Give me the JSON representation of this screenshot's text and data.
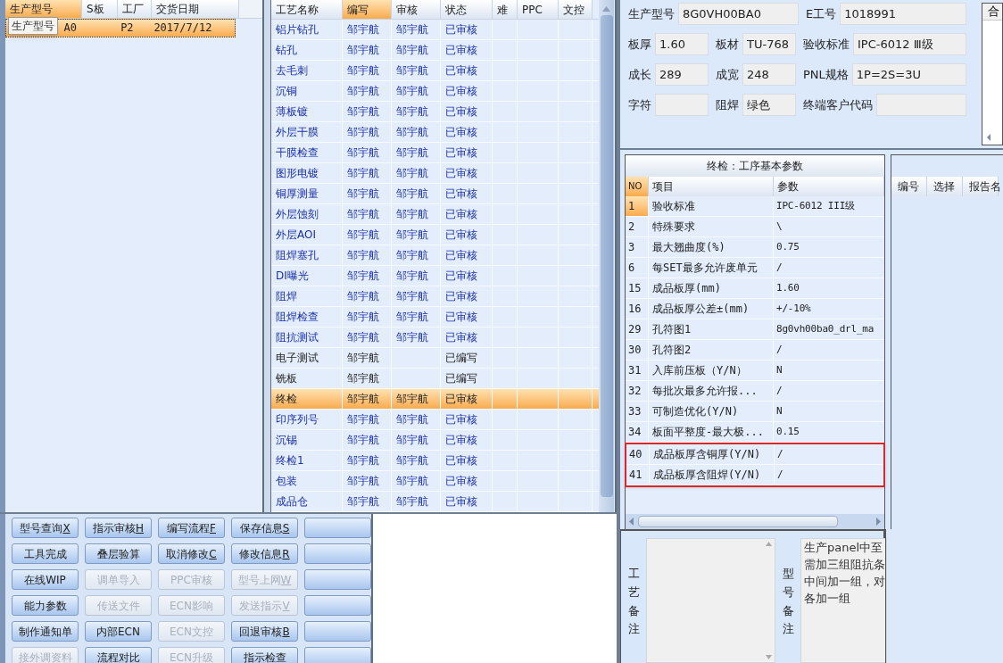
{
  "model_grid": {
    "columns": [
      {
        "label": "生产型号",
        "selected": true
      },
      {
        "label": "S板",
        "selected": false
      },
      {
        "label": "工厂",
        "selected": false
      },
      {
        "label": "交货日期",
        "selected": false
      }
    ],
    "rows": [
      {
        "cells": [
          "A0",
          "",
          "P2",
          "2017/7/12"
        ],
        "selected": true
      }
    ],
    "tooltip": "生产型号"
  },
  "process_grid": {
    "columns": [
      {
        "label": "工艺名称",
        "selected": false
      },
      {
        "label": "编写",
        "selected": true
      },
      {
        "label": "审核",
        "selected": false
      },
      {
        "label": "状态",
        "selected": false
      },
      {
        "label": "难",
        "selected": false
      },
      {
        "label": "PPC",
        "selected": false
      },
      {
        "label": "文控",
        "selected": false
      }
    ],
    "rows": [
      {
        "name": "铝片钻孔",
        "writer": "邹宇航",
        "reviewer": "邹宇航",
        "status": "已审核",
        "reviewed": true,
        "selected": false
      },
      {
        "name": "钻孔",
        "writer": "邹宇航",
        "reviewer": "邹宇航",
        "status": "已审核",
        "reviewed": true,
        "selected": false
      },
      {
        "name": "去毛刺",
        "writer": "邹宇航",
        "reviewer": "邹宇航",
        "status": "已审核",
        "reviewed": true,
        "selected": false
      },
      {
        "name": "沉铜",
        "writer": "邹宇航",
        "reviewer": "邹宇航",
        "status": "已审核",
        "reviewed": true,
        "selected": false
      },
      {
        "name": "薄板镀",
        "writer": "邹宇航",
        "reviewer": "邹宇航",
        "status": "已审核",
        "reviewed": true,
        "selected": false
      },
      {
        "name": "外层干膜",
        "writer": "邹宇航",
        "reviewer": "邹宇航",
        "status": "已审核",
        "reviewed": true,
        "selected": false
      },
      {
        "name": "干膜检查",
        "writer": "邹宇航",
        "reviewer": "邹宇航",
        "status": "已审核",
        "reviewed": true,
        "selected": false
      },
      {
        "name": "图形电镀",
        "writer": "邹宇航",
        "reviewer": "邹宇航",
        "status": "已审核",
        "reviewed": true,
        "selected": false
      },
      {
        "name": "铜厚测量",
        "writer": "邹宇航",
        "reviewer": "邹宇航",
        "status": "已审核",
        "reviewed": true,
        "selected": false
      },
      {
        "name": "外层蚀刻",
        "writer": "邹宇航",
        "reviewer": "邹宇航",
        "status": "已审核",
        "reviewed": true,
        "selected": false
      },
      {
        "name": "外层AOI",
        "writer": "邹宇航",
        "reviewer": "邹宇航",
        "status": "已审核",
        "reviewed": true,
        "selected": false
      },
      {
        "name": "阻焊塞孔",
        "writer": "邹宇航",
        "reviewer": "邹宇航",
        "status": "已审核",
        "reviewed": true,
        "selected": false
      },
      {
        "name": "DI曝光",
        "writer": "邹宇航",
        "reviewer": "邹宇航",
        "status": "已审核",
        "reviewed": true,
        "selected": false
      },
      {
        "name": "阻焊",
        "writer": "邹宇航",
        "reviewer": "邹宇航",
        "status": "已审核",
        "reviewed": true,
        "selected": false
      },
      {
        "name": "阻焊检查",
        "writer": "邹宇航",
        "reviewer": "邹宇航",
        "status": "已审核",
        "reviewed": true,
        "selected": false
      },
      {
        "name": "阻抗测试",
        "writer": "邹宇航",
        "reviewer": "邹宇航",
        "status": "已审核",
        "reviewed": true,
        "selected": false
      },
      {
        "name": "电子测试",
        "writer": "邹宇航",
        "status": "已编写",
        "reviewed": false,
        "selected": false
      },
      {
        "name": "铣板",
        "writer": "邹宇航",
        "status": "已编写",
        "reviewed": false,
        "selected": false
      },
      {
        "name": "终检",
        "writer": "邹宇航",
        "reviewer": "邹宇航",
        "status": "已审核",
        "reviewed": true,
        "selected": true
      },
      {
        "name": "印序列号",
        "writer": "邹宇航",
        "reviewer": "邹宇航",
        "status": "已审核",
        "reviewed": true,
        "selected": false
      },
      {
        "name": "沉锡",
        "writer": "邹宇航",
        "reviewer": "邹宇航",
        "status": "已审核",
        "reviewed": true,
        "selected": false
      },
      {
        "name": "终检1",
        "writer": "邹宇航",
        "reviewer": "邹宇航",
        "status": "已审核",
        "reviewed": true,
        "selected": false
      },
      {
        "name": "包装",
        "writer": "邹宇航",
        "reviewer": "邹宇航",
        "status": "已审核",
        "reviewed": true,
        "selected": false
      },
      {
        "name": "成品仓",
        "writer": "邹宇航",
        "reviewer": "邹宇航",
        "status": "已审核",
        "reviewed": true,
        "selected": false
      }
    ]
  },
  "buttons": [
    [
      {
        "kind": "text",
        "label": "型号查询",
        "shortcut": "X",
        "disabled": false
      },
      {
        "kind": "text",
        "label": "指示审核",
        "shortcut": "H",
        "disabled": false
      },
      {
        "kind": "text",
        "label": "编写流程",
        "shortcut": "F",
        "disabled": false
      },
      {
        "kind": "text",
        "label": "保存信息",
        "shortcut": "S",
        "disabled": false
      },
      {
        "kind": "blank"
      }
    ],
    [
      {
        "kind": "text",
        "label": "工具完成",
        "disabled": false
      },
      {
        "kind": "text",
        "label": "叠层验算",
        "disabled": false
      },
      {
        "kind": "text",
        "label": "取消修改",
        "shortcut": "C",
        "disabled": false
      },
      {
        "kind": "text",
        "label": "修改信息",
        "shortcut": "R",
        "disabled": false
      },
      {
        "kind": "blank"
      }
    ],
    [
      {
        "kind": "text",
        "label": "在线WIP",
        "disabled": false
      },
      {
        "kind": "text",
        "label": "调单导入",
        "disabled": true
      },
      {
        "kind": "text",
        "label": "PPC审核",
        "disabled": true
      },
      {
        "kind": "text",
        "label": "型号上网",
        "shortcut": "W",
        "disabled": true
      },
      {
        "kind": "blank"
      }
    ],
    [
      {
        "kind": "text",
        "label": "能力参数",
        "disabled": false
      },
      {
        "kind": "text",
        "label": "传送文件",
        "disabled": true
      },
      {
        "kind": "text",
        "label": "ECN影响",
        "disabled": true
      },
      {
        "kind": "text",
        "label": "发送指示",
        "shortcut": "V",
        "disabled": true
      },
      {
        "kind": "blank"
      }
    ],
    [
      {
        "kind": "text",
        "label": "制作通知单",
        "disabled": false
      },
      {
        "kind": "text",
        "label": "内部ECN",
        "disabled": false
      },
      {
        "kind": "text",
        "label": "ECN文控",
        "disabled": true
      },
      {
        "kind": "text",
        "label": "回退审核",
        "shortcut": "B",
        "disabled": false
      },
      {
        "kind": "blank"
      }
    ],
    [
      {
        "kind": "text",
        "label": "接外调资料",
        "disabled": true
      },
      {
        "kind": "text",
        "label": "流程对比",
        "disabled": false
      },
      {
        "kind": "text",
        "label": "ECN升级",
        "disabled": true
      },
      {
        "kind": "text",
        "label": "指示检查",
        "disabled": false
      },
      {
        "kind": "blank"
      }
    ]
  ],
  "info_form": [
    [
      {
        "label": "生产型号",
        "value": "8G0VH00BA0"
      },
      {
        "label": "E工号",
        "value": "1018991"
      }
    ],
    [
      {
        "label": "板厚",
        "value": "1.60"
      },
      {
        "label": "板材",
        "value": "TU-768"
      },
      {
        "label": "验收标准",
        "value": "IPC-6012 Ⅲ级"
      }
    ],
    [
      {
        "label": "成长",
        "value": "289"
      },
      {
        "label": "成宽",
        "value": "248"
      },
      {
        "label": "PNL规格",
        "value": "1P=2S=3U"
      }
    ],
    [
      {
        "label": "字符"
      },
      {
        "label": "阻焊",
        "value": "绿色"
      },
      {
        "label": "终端客户代码"
      }
    ]
  ],
  "side_tab": "合",
  "params": {
    "title": "终检：工序基本参数",
    "columns": [
      "NO",
      "项目",
      "参数"
    ],
    "rows": [
      {
        "no": "1",
        "item": "验收标准",
        "value": "IPC-6012 III级",
        "selected": true,
        "highlighted": false
      },
      {
        "no": "2",
        "item": "特殊要求",
        "value": "\\",
        "selected": false,
        "highlighted": false
      },
      {
        "no": "3",
        "item": "最大翘曲度(%)",
        "value": "0.75",
        "selected": false,
        "highlighted": false
      },
      {
        "no": "6",
        "item": "每SET最多允许废单元",
        "value": "/",
        "selected": false,
        "highlighted": false
      },
      {
        "no": "15",
        "item": "成品板厚(mm)",
        "value": "1.60",
        "selected": false,
        "highlighted": false
      },
      {
        "no": "16",
        "item": "成品板厚公差±(mm)",
        "value": "+/-10%",
        "selected": false,
        "highlighted": false
      },
      {
        "no": "29",
        "item": "孔符图1",
        "value": "8g0vh00ba0_drl_ma",
        "selected": false,
        "highlighted": false
      },
      {
        "no": "30",
        "item": "孔符图2",
        "value": "/",
        "selected": false,
        "highlighted": false
      },
      {
        "no": "31",
        "item": "入库前压板（Y/N）",
        "value": "N",
        "selected": false,
        "highlighted": false
      },
      {
        "no": "32",
        "item": "每批次最多允许报...",
        "value": "/",
        "selected": false,
        "highlighted": false
      },
      {
        "no": "33",
        "item": "可制造优化(Y/N)",
        "value": "N",
        "selected": false,
        "highlighted": false
      },
      {
        "no": "34",
        "item": "板面平整度-最大极...",
        "value": "0.15",
        "selected": false,
        "highlighted": false
      },
      {
        "no": "40",
        "item": "成品板厚含铜厚(Y/N)",
        "value": "/",
        "selected": false,
        "highlighted": true
      },
      {
        "no": "41",
        "item": "成品板厚含阻焊(Y/N)",
        "value": "/",
        "selected": false,
        "highlighted": true
      }
    ]
  },
  "reports": {
    "columns": [
      "编号",
      "选择",
      "报告名"
    ]
  },
  "remarks": [
    {
      "label": "工艺备注"
    },
    {
      "label": "型号备注",
      "lines": [
        "生产panel中至",
        "需加三组阻抗条",
        "中间加一组，对",
        "各加一组"
      ]
    }
  ]
}
